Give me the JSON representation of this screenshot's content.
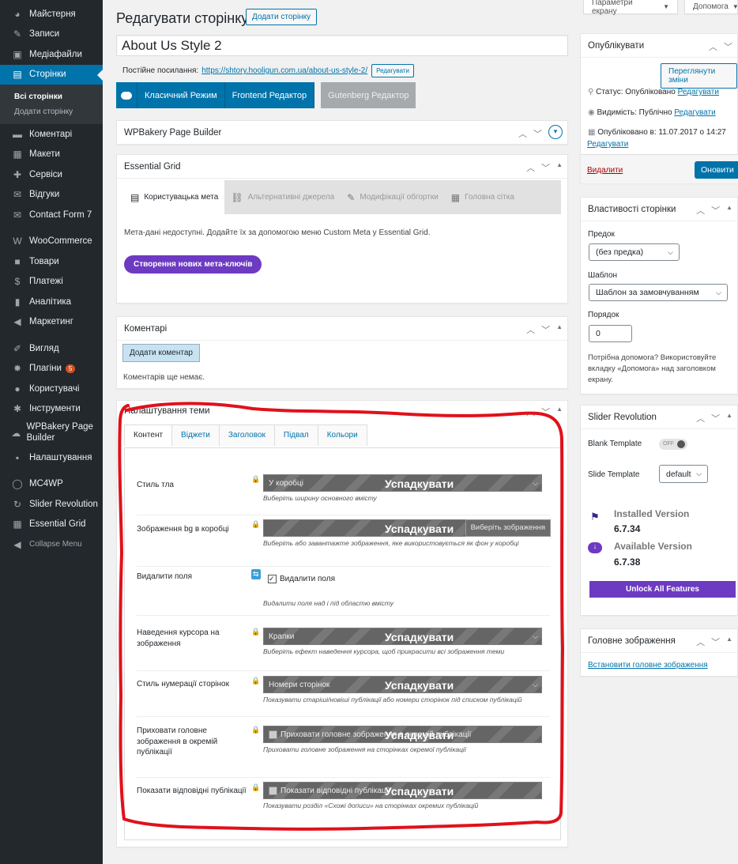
{
  "sidebar": {
    "items": [
      {
        "key": "dashboard",
        "icon": "dashboard-icon",
        "glyph": "◕",
        "label": "Майстерня"
      },
      {
        "key": "posts",
        "icon": "pin-icon",
        "glyph": "✎",
        "label": "Записи"
      },
      {
        "key": "media",
        "icon": "media-icon",
        "glyph": "▣",
        "label": "Медіафайли"
      },
      {
        "key": "pages",
        "icon": "pages-icon",
        "glyph": "▤",
        "label": "Сторінки"
      },
      {
        "key": "comments",
        "icon": "comment-icon",
        "glyph": "▬",
        "label": "Коментарі"
      },
      {
        "key": "layouts",
        "icon": "layout-icon",
        "glyph": "▦",
        "label": "Макети"
      },
      {
        "key": "services",
        "icon": "wrench-icon",
        "glyph": "✚",
        "label": "Сервіси"
      },
      {
        "key": "reviews",
        "icon": "speech-icon",
        "glyph": "✉",
        "label": "Відгуки"
      },
      {
        "key": "cf7",
        "icon": "mail-icon",
        "glyph": "✉",
        "label": "Contact Form 7"
      },
      {
        "key": "woo",
        "icon": "woocommerce-icon",
        "glyph": "W",
        "label": "WooCommerce"
      },
      {
        "key": "products",
        "icon": "archive-icon",
        "glyph": "■",
        "label": "Товари"
      },
      {
        "key": "payments",
        "icon": "payment-icon",
        "glyph": "$",
        "label": "Платежі"
      },
      {
        "key": "analytics",
        "icon": "chart-icon",
        "glyph": "▮",
        "label": "Аналітика"
      },
      {
        "key": "marketing",
        "icon": "megaphone-icon",
        "glyph": "◀",
        "label": "Маркетинг"
      },
      {
        "key": "appearance",
        "icon": "brush-icon",
        "glyph": "✐",
        "label": "Вигляд"
      },
      {
        "key": "plugins",
        "icon": "plugin-icon",
        "glyph": "✸",
        "label": "Плагіни",
        "badge": "5"
      },
      {
        "key": "users",
        "icon": "user-icon",
        "glyph": "●",
        "label": "Користувачі"
      },
      {
        "key": "tools",
        "icon": "tools-icon",
        "glyph": "✱",
        "label": "Інструменти"
      },
      {
        "key": "wpbakery",
        "icon": "wpbakery-icon",
        "glyph": "☁",
        "label": "WPBakery Page Builder"
      },
      {
        "key": "settings",
        "icon": "settings-icon",
        "glyph": "▪",
        "label": "Налаштування"
      },
      {
        "key": "mc4wp",
        "icon": "mc4wp-icon",
        "glyph": "◯",
        "label": "MC4WP"
      },
      {
        "key": "slider",
        "icon": "refresh-icon",
        "glyph": "↻",
        "label": "Slider Revolution"
      },
      {
        "key": "egrid",
        "icon": "grid-icon",
        "glyph": "▦",
        "label": "Essential Grid"
      },
      {
        "key": "collapse",
        "icon": "collapse-icon",
        "glyph": "◀",
        "label": "Collapse Menu"
      }
    ],
    "submenu": [
      "Всі сторінки",
      "Додати сторінку"
    ]
  },
  "top": {
    "screen_options": "Параметри екрану",
    "help": "Допомога"
  },
  "header": {
    "title": "Редагувати сторінку",
    "add_new": "Додати сторінку"
  },
  "post": {
    "title": "About Us Style 2",
    "permalink_label": "Постійне посилання:",
    "permalink_url": "https://shtory.hooligun.com.ua/about-us-style-2/",
    "edit": "Редагувати"
  },
  "modes": {
    "classic": "Класичний Режим",
    "frontend": "Frontend Редактор",
    "gutenberg": "Gutenberg Редактор"
  },
  "wpbakery": {
    "title": "WPBakery Page Builder"
  },
  "essential_grid": {
    "title": "Essential Grid",
    "tabs": [
      "Користувацька мета",
      "Альтернативні джерела",
      "Модифікації обгортки",
      "Головна сітка"
    ],
    "message": "Мета-дані недоступні. Додайте їх за допомогою меню Custom Meta у Essential Grid.",
    "create_button": "Створення нових мета-ключів"
  },
  "comments": {
    "title": "Коментарі",
    "add": "Додати коментар",
    "empty": "Коментарів ще немає."
  },
  "theme": {
    "title": "Налаштування теми",
    "tabs": [
      "Контент",
      "Віджети",
      "Заголовок",
      "Підвал",
      "Кольори"
    ],
    "inherit": "Успадкувати",
    "rows": [
      {
        "label": "Стиль тла",
        "value": "У коробці",
        "desc": "Виберіть ширину основного вмісту"
      },
      {
        "label": "Зображення bg в коробці",
        "button": "Виберіть зображення",
        "desc": "Виберіть або завантажте зображення, яке використовується як фон у коробці"
      },
      {
        "label": "Видалити поля",
        "value": "Видалити поля",
        "desc": "Видалити поля над і під областю вмісту"
      },
      {
        "label": "Наведення курсора на зображення",
        "value": "Крапки",
        "desc": "Виберіть ефект наведення курсора, щоб прикрасити всі зображення теми"
      },
      {
        "label": "Стиль нумерації сторінок",
        "value": "Номери сторінок",
        "desc": "Показувати старіші/новіші публікації або номери сторінок під списком публікацій"
      },
      {
        "label": "Приховати головне зображення в окремій публікації",
        "value": "Приховати головне зображення в окремій публікації",
        "desc": "Приховати головне зображення на сторінках окремої публікації"
      },
      {
        "label": "Показати відповідні публікації",
        "value": "Показати відповідні публікації",
        "desc": "Показувати розділ «Схожі дописи» на сторінках окремих публікацій"
      }
    ]
  },
  "publish": {
    "title": "Опублікувати",
    "preview": "Переглянути зміни",
    "status_label": "Статус:",
    "status": "Опубліковано",
    "visibility_label": "Видимість:",
    "visibility": "Публічно",
    "published_label": "Опубліковано в:",
    "published": "11.07.2017 о 14:27",
    "edit": "Редагувати",
    "delete": "Видалити",
    "update": "Оновити"
  },
  "attributes": {
    "title": "Властивості сторінки",
    "parent_label": "Предок",
    "parent": "(без предка)",
    "template_label": "Шаблон",
    "template": "Шаблон за замовчуванням",
    "order_label": "Порядок",
    "order": "0",
    "help": "Потрібна допомога? Використовуйте вкладку «Допомога» над заголовком екрану."
  },
  "slider": {
    "title": "Slider Revolution",
    "blank_label": "Blank Template",
    "blank_value": "OFF",
    "slide_label": "Slide Template",
    "slide_value": "default",
    "installed_label": "Installed Version",
    "installed": "6.7.34",
    "available_label": "Available Version",
    "available": "6.7.38",
    "unlock": "Unlock All Features"
  },
  "featured": {
    "title": "Головне зображення",
    "set": "Встановити головне зображення"
  },
  "colors": {
    "wp_blue": "#0073aa",
    "sidebar_bg": "#23282d",
    "purple": "#6d3ac2",
    "annotation_red": "#e0111b"
  }
}
